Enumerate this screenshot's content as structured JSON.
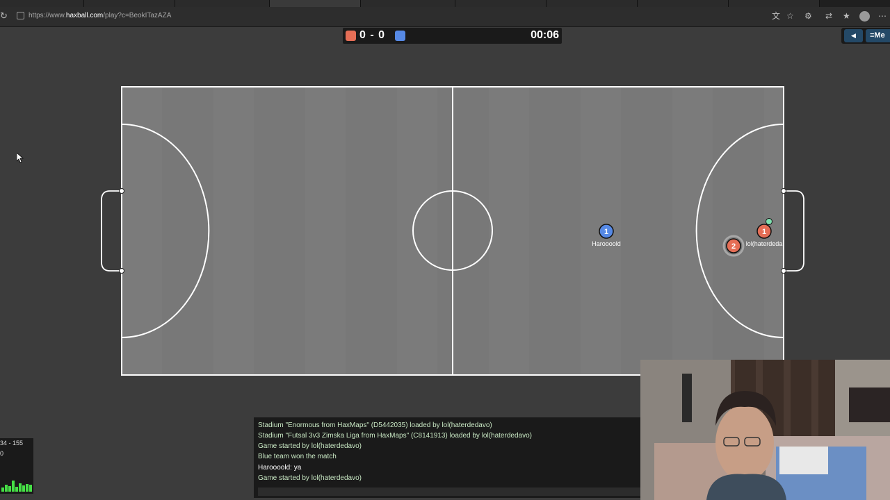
{
  "browser": {
    "url": {
      "prefix": "https://www.",
      "domain": "haxball.com",
      "suffix": "/play?c=BeokITazAZA"
    },
    "icons": [
      "reload-icon",
      "site-info-icon",
      "translate-icon",
      "bookmark-star-icon",
      "extensions-icon",
      "sync-icon",
      "favorites-icon",
      "profile-avatar-icon",
      "more-menu-icon"
    ]
  },
  "scoreboard": {
    "score": "0 - 0",
    "time": "00:06",
    "red_color": "#e56e56",
    "blue_color": "#5689e5"
  },
  "top_menu": {
    "mute_icon": "speaker-icon",
    "menu_label": "Me"
  },
  "players": [
    {
      "team": "blue",
      "number": "1",
      "name": "Haroooold",
      "color": "#5689e5"
    },
    {
      "team": "red",
      "number": "1",
      "name": "lol(haterdeda",
      "color": "#e56e56"
    },
    {
      "team": "red",
      "number": "2",
      "name": "",
      "color": "#e56e56"
    }
  ],
  "chat": {
    "messages": [
      {
        "text": "Stadium \"Enormous from HaxMaps\" (D5442035) loaded by lol(haterdedavo)",
        "kind": "system"
      },
      {
        "text": "Stadium \"Futsal 3v3 Zimska Liga from HaxMaps\" (C8141913) loaded by lol(haterdedavo)",
        "kind": "system"
      },
      {
        "text": "Game started by lol(haterdedavo)",
        "kind": "system"
      },
      {
        "text": "Blue team won the match",
        "kind": "system"
      },
      {
        "text": "Haroooold: ya",
        "kind": "user"
      },
      {
        "text": "Game started by lol(haterdedavo)",
        "kind": "system"
      }
    ]
  },
  "stats": {
    "line1": "34 - 155",
    "line2": "0"
  }
}
